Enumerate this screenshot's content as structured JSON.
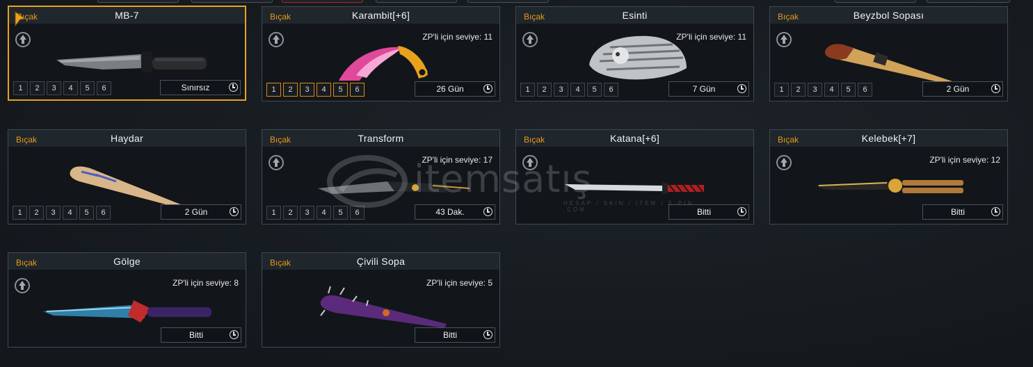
{
  "cards": [
    {
      "category": "Bıçak",
      "name": "MB-7",
      "zp": "",
      "levels": [
        "1",
        "2",
        "3",
        "4",
        "5",
        "6"
      ],
      "duration": "Sınırsız"
    },
    {
      "category": "Bıçak",
      "name": "Karambit[+6]",
      "zp": "ZP'li için seviye: 11",
      "levels": [
        "1",
        "2",
        "3",
        "4",
        "5",
        "6"
      ],
      "duration": "26 Gün"
    },
    {
      "category": "Bıçak",
      "name": "Esinti",
      "zp": "ZP'li için seviye: 11",
      "levels": [
        "1",
        "2",
        "3",
        "4",
        "5",
        "6"
      ],
      "duration": "7 Gün"
    },
    {
      "category": "Bıçak",
      "name": "Beyzbol Sopası",
      "zp": "",
      "levels": [
        "1",
        "2",
        "3",
        "4",
        "5",
        "6"
      ],
      "duration": "2 Gün"
    },
    {
      "category": "Bıçak",
      "name": "Haydar",
      "zp": "",
      "levels": [
        "1",
        "2",
        "3",
        "4",
        "5",
        "6"
      ],
      "duration": "2 Gün"
    },
    {
      "category": "Bıçak",
      "name": "Transform",
      "zp": "ZP'li için seviye: 17",
      "levels": [
        "1",
        "2",
        "3",
        "4",
        "5",
        "6"
      ],
      "duration": "43 Dak."
    },
    {
      "category": "Bıçak",
      "name": "Katana[+6]",
      "zp": "",
      "levels": [],
      "duration": "Bitti"
    },
    {
      "category": "Bıçak",
      "name": "Kelebek[+7]",
      "zp": "ZP'li için seviye: 12",
      "levels": [],
      "duration": "Bitti"
    },
    {
      "category": "Bıçak",
      "name": "Gölge",
      "zp": "ZP'li için seviye: 8",
      "levels": [],
      "duration": "Bitti"
    },
    {
      "category": "Bıçak",
      "name": "Çivili Sopa",
      "zp": "ZP'li için seviye: 5",
      "levels": [],
      "duration": "Bitti"
    }
  ],
  "icons": {
    "upgrade": "upgrade-arrow-icon",
    "clock": "clock-icon",
    "cursor": "pointer-cursor-icon"
  },
  "watermark": {
    "text": "itemsatış",
    "sub": "HESAP / SKIN / ITEM / E-PIN .COM"
  },
  "colors": {
    "accent": "#e9a21d",
    "category": "#e89a1a",
    "card_border": "#3e4a52"
  }
}
